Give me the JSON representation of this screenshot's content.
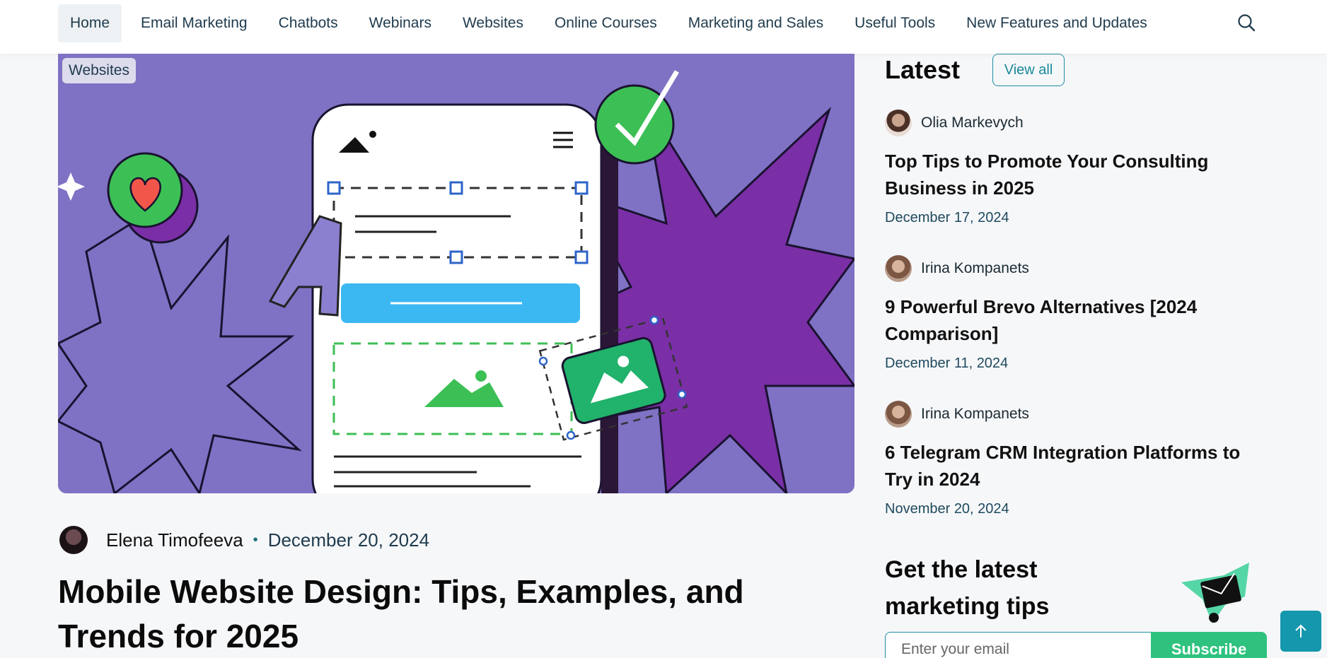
{
  "nav": {
    "items": [
      {
        "label": "Home",
        "active": true
      },
      {
        "label": "Email Marketing"
      },
      {
        "label": "Chatbots"
      },
      {
        "label": "Webinars"
      },
      {
        "label": "Websites"
      },
      {
        "label": "Online Courses"
      },
      {
        "label": "Marketing and Sales"
      },
      {
        "label": "Useful Tools"
      },
      {
        "label": "New Features and Updates"
      }
    ],
    "search_icon": "search-icon"
  },
  "featured": {
    "tag": "Websites",
    "author": "Elena Timofeeva",
    "separator": "•",
    "date": "December 20, 2024",
    "title": "Mobile Website Design: Tips, Examples, and Trends for 2025"
  },
  "sidebar": {
    "heading": "Latest",
    "view_all": "View all",
    "posts": [
      {
        "author": "Olia Markevych",
        "title": "Top Tips to Promote Your Consulting Business in 2025",
        "date": "December 17, 2024"
      },
      {
        "author": "Irina Kompanets",
        "title": "9 Powerful Brevo Alternatives [2024 Comparison]",
        "date": "December 11, 2024"
      },
      {
        "author": "Irina Kompanets",
        "title": "6 Telegram CRM Integration Platforms to Try in 2024",
        "date": "November 20, 2024"
      }
    ],
    "newsletter": {
      "heading": "Get the latest marketing tips",
      "email_placeholder": "Enter your email",
      "subscribe": "Subscribe"
    }
  },
  "colors": {
    "accent": "#1597ad",
    "subscribe": "#2ec27e",
    "hero_bg": "#7f72c4"
  }
}
